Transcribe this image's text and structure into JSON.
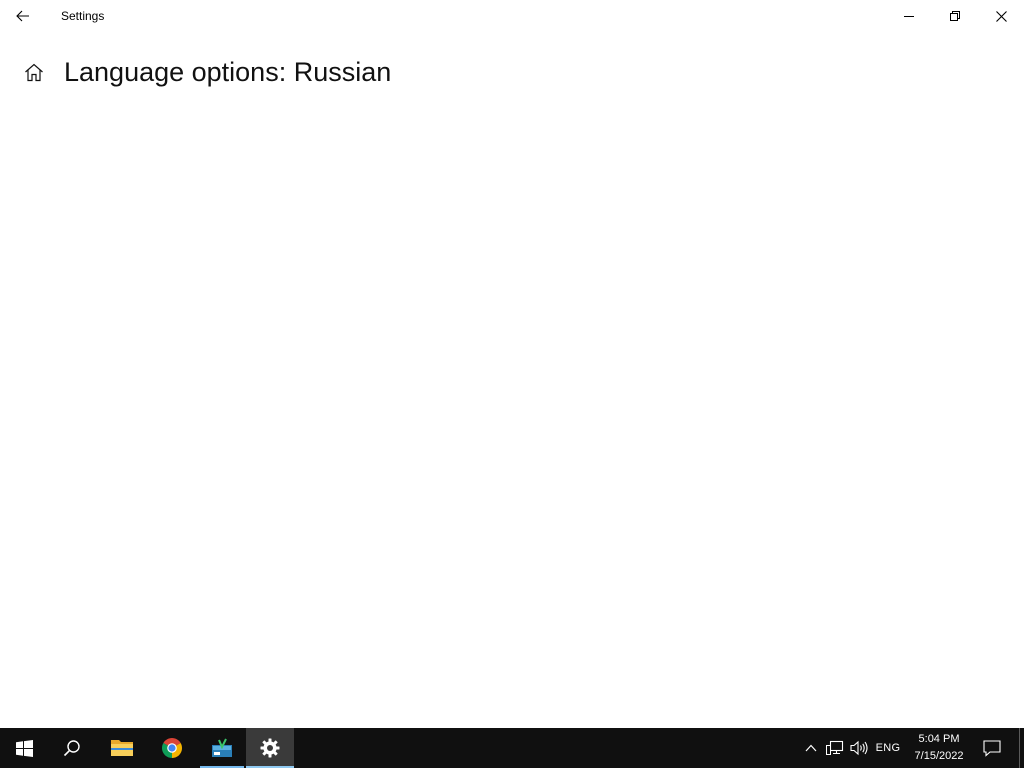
{
  "window": {
    "app_title": "Settings",
    "page_title": "Language options: Russian",
    "icons": {
      "back": "back-arrow-icon",
      "home": "home-icon",
      "minimize": "minimize-icon",
      "maximize": "restore-icon",
      "close": "close-icon"
    }
  },
  "taskbar": {
    "background": "#101010",
    "apps": [
      {
        "name": "start",
        "icon": "windows-logo-icon"
      },
      {
        "name": "search",
        "icon": "search-icon"
      },
      {
        "name": "file-explorer",
        "icon": "folder-icon"
      },
      {
        "name": "chrome",
        "icon": "chrome-icon"
      },
      {
        "name": "app",
        "icon": "app-icon",
        "running": true
      },
      {
        "name": "settings",
        "icon": "gear-icon",
        "running": true,
        "active": true
      }
    ],
    "tray": {
      "language": "ENG",
      "time": "5:04 PM",
      "date": "7/15/2022"
    }
  }
}
